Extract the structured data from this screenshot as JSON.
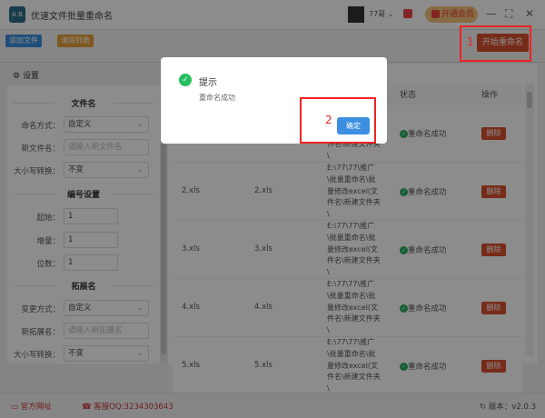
{
  "app": {
    "title": "优速文件批量重命名",
    "user": "77哥",
    "vip_label": "开通会员",
    "logo_text": "AB"
  },
  "toolbar": {
    "add_files": "添加文件",
    "clear_list": "清除列表",
    "start_rename": "开始重命名"
  },
  "settings": {
    "title": "设置",
    "filename_section": "文件名",
    "naming_mode_label": "命名方式：",
    "naming_mode_value": "自定义",
    "new_name_label": "新文件名：",
    "new_name_placeholder": "请输入新文件名",
    "case_label": "大小写转换：",
    "case_value": "不变",
    "numbering_section": "编号设置",
    "start_label": "起始：",
    "start_value": "1",
    "step_label": "增量：",
    "step_value": "1",
    "digits_label": "位数：",
    "digits_value": "1",
    "ext_section": "拓展名",
    "ext_mode_label": "变更方式：",
    "ext_mode_value": "自定义",
    "new_ext_label": "新拓展名：",
    "new_ext_placeholder": "请输入新拓展名",
    "ext_case_label": "大小写转换：",
    "ext_case_value": "不变"
  },
  "table": {
    "headers": {
      "status": "状态",
      "action": "操作"
    },
    "rows": [
      {
        "name": "",
        "new_name": "",
        "path": "E:\\77\\77\\推广\\批量重命名\\批量修改excel(文件名\\新建文件夹\\",
        "status": "重命名成功",
        "action": "删除"
      },
      {
        "name": "2.xls",
        "new_name": "2.xls",
        "path": "E:\\77\\77\\推广\\批量重命名\\批量修改excel(文件名\\新建文件夹\\",
        "status": "重命名成功",
        "action": "删除"
      },
      {
        "name": "3.xls",
        "new_name": "3.xls",
        "path": "E:\\77\\77\\推广\\批量重命名\\批量修改excel(文件名\\新建文件夹\\",
        "status": "重命名成功",
        "action": "删除"
      },
      {
        "name": "4.xls",
        "new_name": "4.xls",
        "path": "E:\\77\\77\\推广\\批量重命名\\批量修改excel(文件名\\新建文件夹\\",
        "status": "重命名成功",
        "action": "删除"
      },
      {
        "name": "5.xls",
        "new_name": "5.xls",
        "path": "E:\\77\\77\\推广\\批量重命名\\批量修改excel(文件名\\新建文件夹\\",
        "status": "重命名成功",
        "action": "删除"
      }
    ]
  },
  "footer": {
    "website": "官方网址",
    "support": "客服QQ:3234303643",
    "version": "版本：v2.0.3"
  },
  "dialog": {
    "title": "提示",
    "message": "重命名成功",
    "ok": "确定"
  },
  "annotations": {
    "step1": "1",
    "step2": "2"
  }
}
